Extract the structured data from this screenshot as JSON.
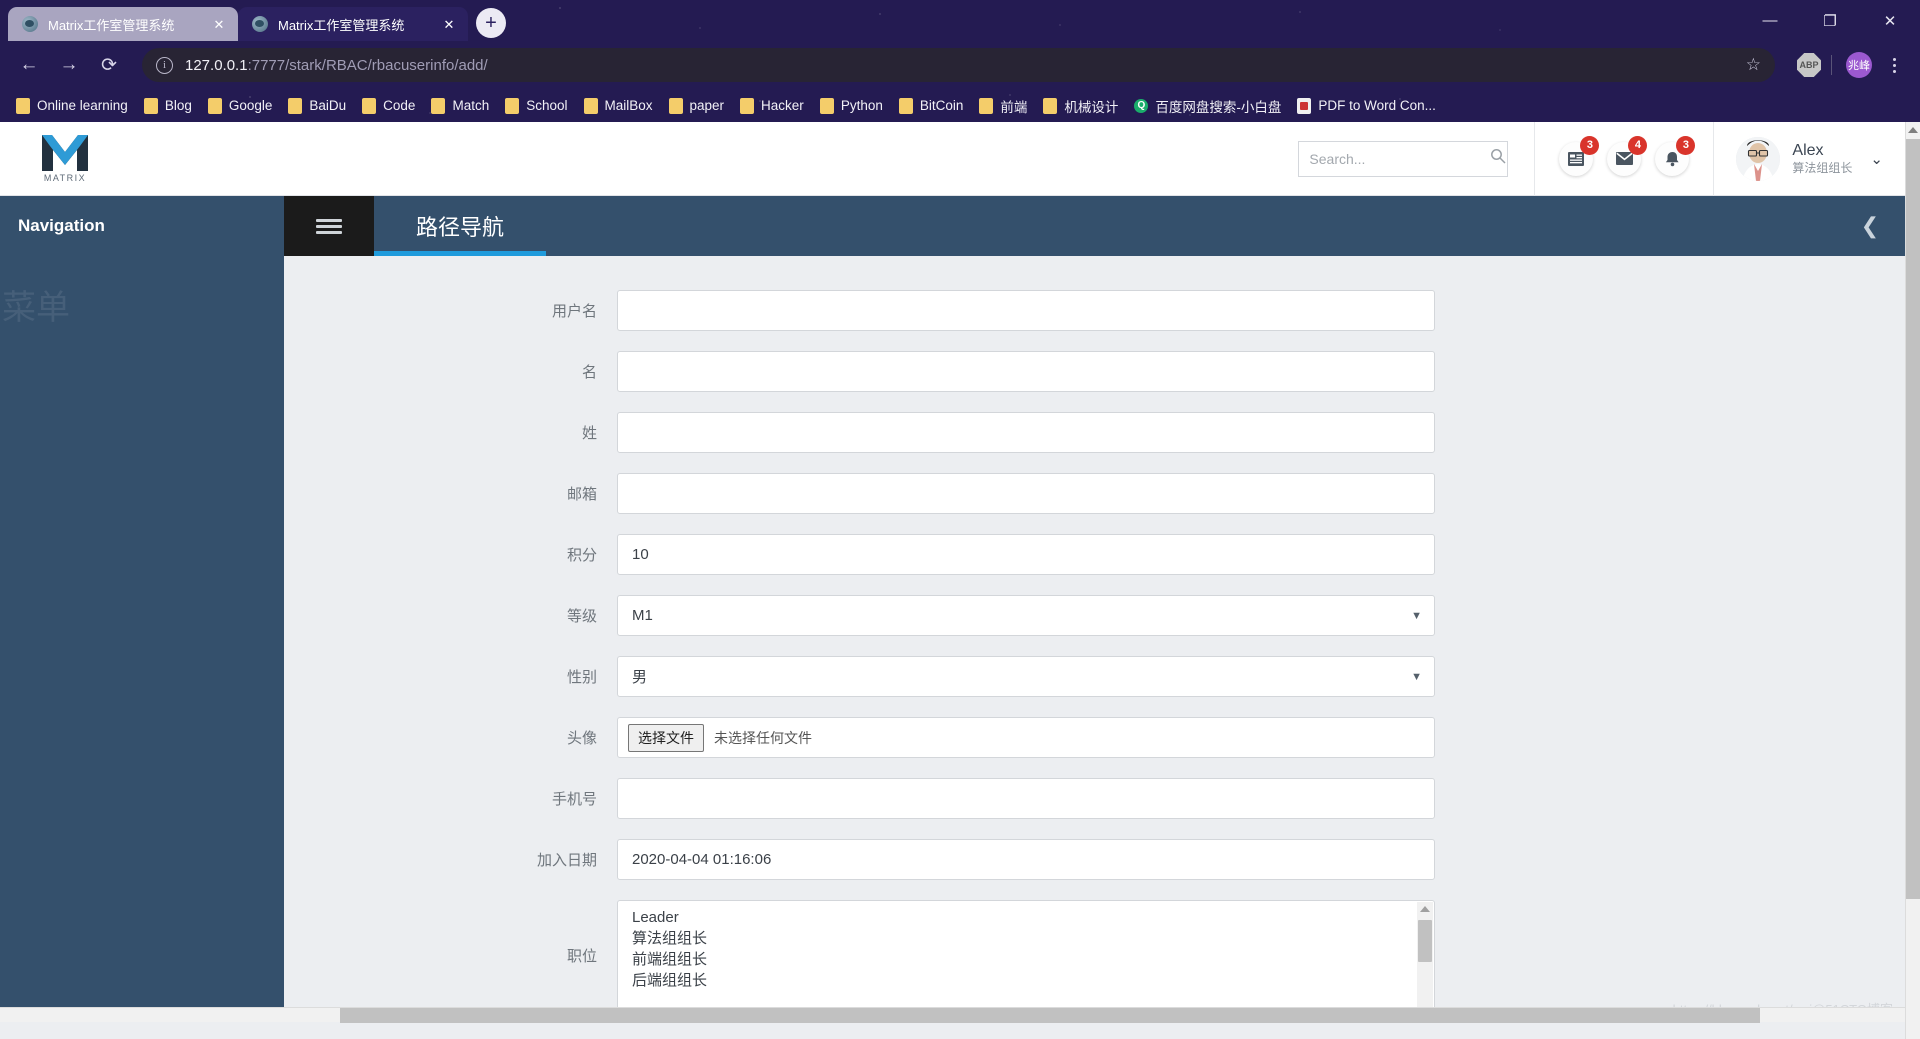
{
  "browser": {
    "tabs": [
      {
        "title": "Matrix工作室管理系统",
        "active": false,
        "close": "✕"
      },
      {
        "title": "Matrix工作室管理系统",
        "active": true,
        "close": "✕"
      }
    ],
    "new_tab_label": "+",
    "window_controls": {
      "minimize": "—",
      "maximize": "❐",
      "close": "✕"
    },
    "nav": {
      "back": "←",
      "forward": "→",
      "reload": "⟳"
    },
    "omnibox": {
      "info_icon": "i",
      "url_host": "127.0.0.1",
      "url_path": ":7777/stark/RBAC/rbacuserinfo/add/",
      "star": "☆"
    },
    "extensions": {
      "abp_label": "ABP"
    },
    "profile_avatar": "兆峰",
    "bookmarks": [
      {
        "label": "Online learning",
        "icon": "folder"
      },
      {
        "label": "Blog",
        "icon": "folder"
      },
      {
        "label": "Google",
        "icon": "folder"
      },
      {
        "label": "BaiDu",
        "icon": "folder"
      },
      {
        "label": "Code",
        "icon": "folder"
      },
      {
        "label": "Match",
        "icon": "folder"
      },
      {
        "label": "School",
        "icon": "folder"
      },
      {
        "label": "MailBox",
        "icon": "folder"
      },
      {
        "label": "paper",
        "icon": "folder"
      },
      {
        "label": "Hacker",
        "icon": "folder"
      },
      {
        "label": "Python",
        "icon": "folder"
      },
      {
        "label": "BitCoin",
        "icon": "folder"
      },
      {
        "label": "前端",
        "icon": "folder"
      },
      {
        "label": "机械设计",
        "icon": "folder"
      },
      {
        "label": "百度网盘搜索-小白盘",
        "icon": "search-green"
      },
      {
        "label": "PDF to Word Con...",
        "icon": "pdf"
      }
    ]
  },
  "app": {
    "logo_text": "MATRIX",
    "search": {
      "placeholder": "Search...",
      "value": ""
    },
    "header_icons": [
      {
        "name": "tasks-icon",
        "glyph": "▤",
        "badge": "3"
      },
      {
        "name": "mail-icon",
        "glyph": "✉",
        "badge": "4"
      },
      {
        "name": "bell-icon",
        "glyph": "🔔",
        "badge": "3"
      }
    ],
    "user": {
      "name": "Alex",
      "role": "算法组组长",
      "chevron": "⌄"
    },
    "navbar": {
      "nav_label": "Navigation",
      "burger": "≡",
      "breadcrumb_title": "路径导航",
      "collapse_icon": "❮",
      "accent_color": "#1f9bdc"
    },
    "sidebar": {
      "menu_ghost_label": "菜单"
    },
    "form": {
      "rows": [
        {
          "label": "用户名",
          "type": "text",
          "value": ""
        },
        {
          "label": "名",
          "type": "text",
          "value": ""
        },
        {
          "label": "姓",
          "type": "text",
          "value": ""
        },
        {
          "label": "邮箱",
          "type": "text",
          "value": ""
        },
        {
          "label": "积分",
          "type": "text",
          "value": "10"
        },
        {
          "label": "等级",
          "type": "select",
          "value": "M1",
          "caret": "▼"
        },
        {
          "label": "性别",
          "type": "select",
          "value": "男",
          "caret": "▼"
        },
        {
          "label": "头像",
          "type": "file",
          "button_label": "选择文件",
          "status": "未选择任何文件"
        },
        {
          "label": "手机号",
          "type": "text",
          "value": ""
        },
        {
          "label": "加入日期",
          "type": "text",
          "value": "2020-04-04 01:16:06"
        },
        {
          "label": "职位",
          "type": "listbox",
          "options": [
            "Leader",
            "算法组组长",
            "前端组组长",
            "后端组组长"
          ]
        }
      ]
    },
    "watermark": "https://blog.csdn.net/wei@51CTO博客"
  }
}
